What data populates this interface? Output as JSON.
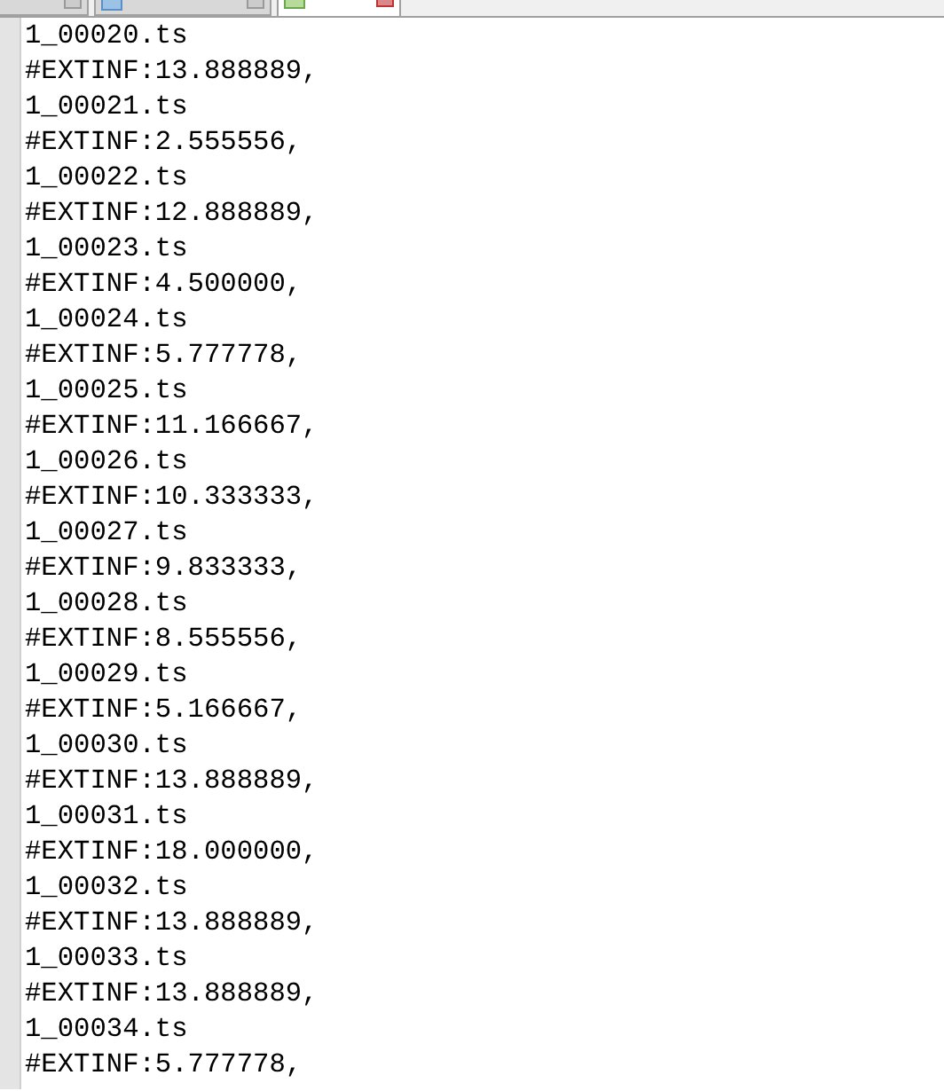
{
  "tabs": [
    {
      "selected": false
    },
    {
      "selected": false
    },
    {
      "selected": true
    }
  ],
  "lines": [
    "1_00020.ts",
    "#EXTINF:13.888889,",
    "1_00021.ts",
    "#EXTINF:2.555556,",
    "1_00022.ts",
    "#EXTINF:12.888889,",
    "1_00023.ts",
    "#EXTINF:4.500000,",
    "1_00024.ts",
    "#EXTINF:5.777778,",
    "1_00025.ts",
    "#EXTINF:11.166667,",
    "1_00026.ts",
    "#EXTINF:10.333333,",
    "1_00027.ts",
    "#EXTINF:9.833333,",
    "1_00028.ts",
    "#EXTINF:8.555556,",
    "1_00029.ts",
    "#EXTINF:5.166667,",
    "1_00030.ts",
    "#EXTINF:13.888889,",
    "1_00031.ts",
    "#EXTINF:18.000000,",
    "1_00032.ts",
    "#EXTINF:13.888889,",
    "1_00033.ts",
    "#EXTINF:13.888889,",
    "1_00034.ts",
    "#EXTINF:5.777778,"
  ]
}
